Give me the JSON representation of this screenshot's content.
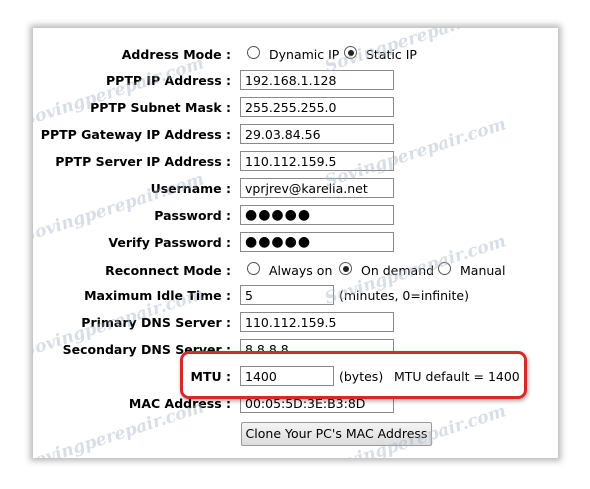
{
  "watermark": "Sovingperepair.com",
  "form": {
    "address_mode": {
      "label": "Address Mode :",
      "options": [
        "Dynamic IP",
        "Static IP"
      ],
      "selected": "Static IP"
    },
    "pptp_ip": {
      "label": "PPTP IP Address :",
      "value": "192.168.1.128"
    },
    "pptp_mask": {
      "label": "PPTP Subnet Mask :",
      "value": "255.255.255.0"
    },
    "pptp_gateway": {
      "label": "PPTP Gateway IP Address :",
      "value": "29.03.84.56"
    },
    "pptp_server": {
      "label": "PPTP Server IP Address :",
      "value": "110.112.159.5"
    },
    "username": {
      "label": "Username :",
      "value": "vprjrev@karelia.net"
    },
    "password": {
      "label": "Password :",
      "value": "●●●●●"
    },
    "verify_password": {
      "label": "Verify Password :",
      "value": "●●●●●"
    },
    "reconnect_mode": {
      "label": "Reconnect Mode :",
      "options": [
        "Always on",
        "On demand",
        "Manual"
      ],
      "selected": "On demand"
    },
    "max_idle": {
      "label": "Maximum Idle Time :",
      "value": "5",
      "suffix": "(minutes, 0=infinite)"
    },
    "primary_dns": {
      "label": "Primary DNS Server :",
      "value": "110.112.159.5"
    },
    "secondary_dns": {
      "label": "Secondary DNS Server :",
      "value": "8.8.8.8"
    },
    "mtu": {
      "label": "MTU :",
      "value": "1400",
      "suffix": "(bytes)",
      "default_note": "MTU default = 1400"
    },
    "mac": {
      "label": "MAC Address :",
      "value": "00:05:5D:3E:B3:8D"
    },
    "clone_button": "Clone Your PC's MAC Address"
  },
  "colors": {
    "highlight": "#d42a2a"
  }
}
